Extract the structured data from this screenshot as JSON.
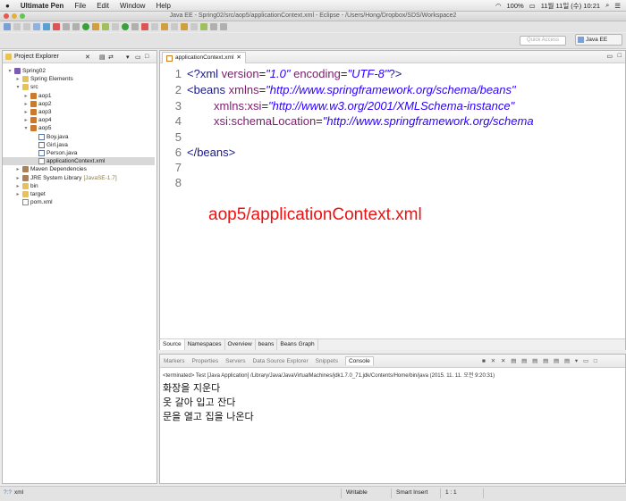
{
  "menubar": {
    "apple": "",
    "app_name": "Ultimate Pen",
    "items": [
      "File",
      "Edit",
      "Window",
      "Help"
    ],
    "battery": "100%",
    "datetime": "11월 11일 (수)  10:21"
  },
  "window": {
    "title": "Java EE - Spring02/src/aop5/applicationContext.xml - Eclipse - /Users/Hong/Dropbox/SDS/Workspace2"
  },
  "toolbar": {
    "quick_access_placeholder": "Quick Access",
    "perspective_label": "Java EE"
  },
  "project_explorer": {
    "title": "Project Explorer",
    "tree": [
      {
        "label": "Spring02",
        "depth": 0,
        "expanded": true,
        "icon": "project-icon"
      },
      {
        "label": "Spring Elements",
        "depth": 1,
        "icon": "spring-icon"
      },
      {
        "label": "src",
        "depth": 1,
        "expanded": true,
        "icon": "source-folder-icon"
      },
      {
        "label": "aop1",
        "depth": 2,
        "icon": "package-icon"
      },
      {
        "label": "aop2",
        "depth": 2,
        "icon": "package-icon"
      },
      {
        "label": "aop3",
        "depth": 2,
        "icon": "package-icon"
      },
      {
        "label": "aop4",
        "depth": 2,
        "icon": "package-icon"
      },
      {
        "label": "aop5",
        "depth": 2,
        "expanded": true,
        "icon": "package-icon"
      },
      {
        "label": "Boy.java",
        "depth": 3,
        "icon": "java-file-icon"
      },
      {
        "label": "Girl.java",
        "depth": 3,
        "icon": "java-file-icon"
      },
      {
        "label": "Person.java",
        "depth": 3,
        "icon": "java-file-icon"
      },
      {
        "label": "applicationContext.xml",
        "depth": 3,
        "icon": "xml-file-icon",
        "selected": true
      },
      {
        "label": "Maven Dependencies",
        "depth": 1,
        "icon": "library-icon"
      },
      {
        "label": "JRE System Library",
        "suffix": "[JavaSE-1.7]",
        "depth": 1,
        "icon": "library-icon"
      },
      {
        "label": "bin",
        "depth": 1,
        "icon": "folder-icon"
      },
      {
        "label": "target",
        "depth": 1,
        "icon": "folder-icon"
      },
      {
        "label": "pom.xml",
        "depth": 1,
        "icon": "xml-file-icon"
      }
    ]
  },
  "editor": {
    "tab_label": "applicationContext.xml",
    "lines": {
      "n1": "1",
      "n2": "2",
      "n3": "3",
      "n4": "4",
      "n5": "5",
      "n6": "6",
      "n7": "7",
      "n8": "8",
      "l1_open": "<?xml ",
      "l1_a1": "version",
      "l1_eq1": "=",
      "l1_v1": "\"1.0\"",
      "l1_a2": " encoding",
      "l1_eq2": "=",
      "l1_v2": "\"UTF-8\"",
      "l1_close": "?>",
      "l2_tag": "<beans ",
      "l2_attr": "xmlns",
      "l2_eq": "=",
      "l2_val": "\"http://www.springframework.org/schema/beans\"",
      "l3_attr": "xmlns:xsi",
      "l3_eq": "=",
      "l3_val": "\"http://www.w3.org/2001/XMLSchema-instance\"",
      "l4_attr": "xsi:schemaLocation",
      "l4_eq": "=",
      "l4_val": "\"http://www.springframework.org/schema",
      "l6": "</beans>"
    },
    "overlay_annotation": "aop5/applicationContext.xml",
    "bottom_tabs": [
      "Source",
      "Namespaces",
      "Overview",
      "beans",
      "Beans Graph"
    ]
  },
  "console": {
    "tabs": [
      "Markers",
      "Properties",
      "Servers",
      "Data Source Explorer",
      "Snippets",
      "Console"
    ],
    "info": "<terminated> Test [Java Application] /Library/Java/JavaVirtualMachines/jdk1.7.0_71.jdk/Contents/Home/bin/java (2015. 11. 11. 오전 9:20:31)",
    "output": [
      "화장을 지운다",
      "옷 갈아 입고 잔다",
      "문을 열고 집을 나온다"
    ]
  },
  "status": {
    "left_icon_text": "?:?",
    "left_label": "xml",
    "mode": "Writable",
    "insert": "Smart Insert",
    "position": "1 : 1"
  },
  "colors": {
    "overlay_red": "#ee1111",
    "xml_tag": "#1a1a8a",
    "xml_attr": "#7a1c6b",
    "xml_value": "#2a00ff"
  }
}
